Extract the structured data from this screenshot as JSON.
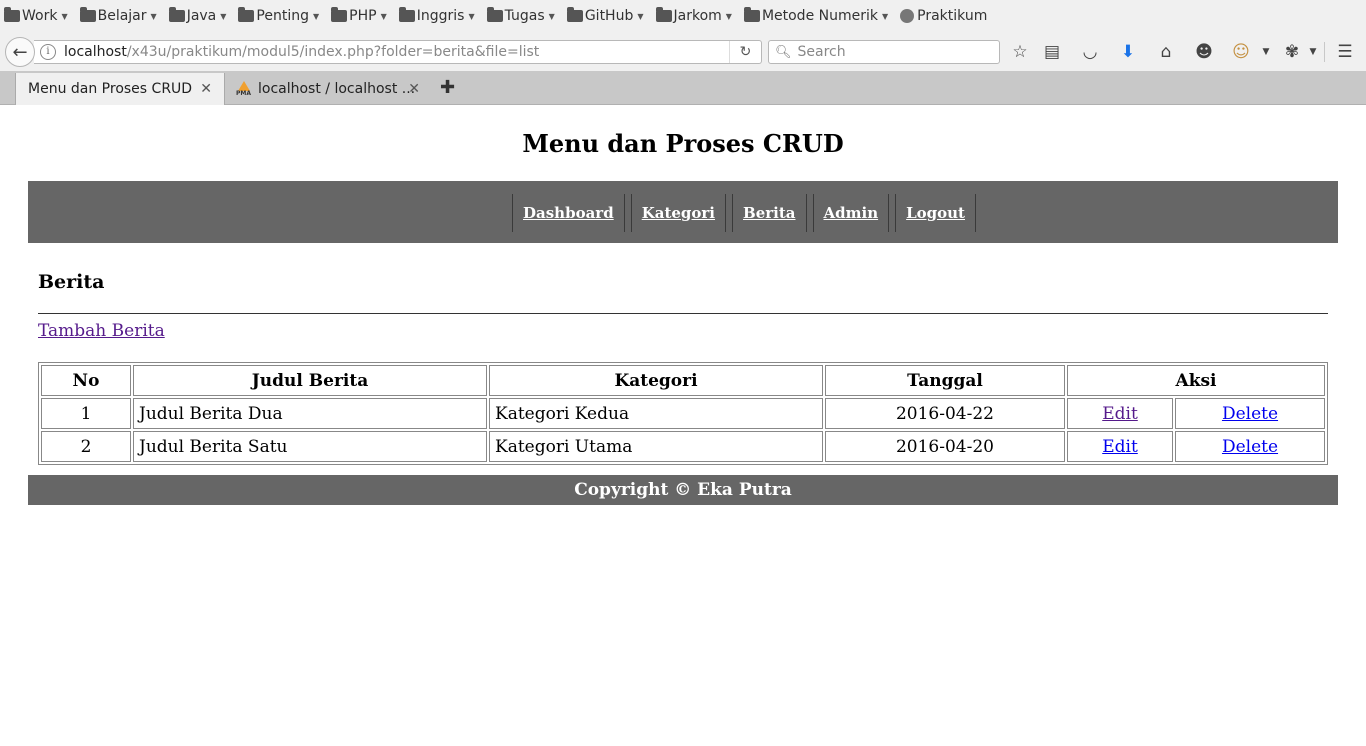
{
  "browser": {
    "bookmarks": [
      {
        "label": "Work",
        "type": "folder"
      },
      {
        "label": "Belajar",
        "type": "folder"
      },
      {
        "label": "Java",
        "type": "folder"
      },
      {
        "label": "Penting",
        "type": "folder"
      },
      {
        "label": "PHP",
        "type": "folder"
      },
      {
        "label": "Inggris",
        "type": "folder"
      },
      {
        "label": "Tugas",
        "type": "folder"
      },
      {
        "label": "GitHub",
        "type": "folder"
      },
      {
        "label": "Jarkom",
        "type": "folder"
      },
      {
        "label": "Metode Numerik",
        "type": "folder"
      },
      {
        "label": "Praktikum",
        "type": "link"
      }
    ],
    "url_host": "localhost",
    "url_path": "/x43u/praktikum/modul5/index.php?folder=berita&file=list",
    "search_placeholder": "Search",
    "tabs": [
      {
        "title": "Menu dan Proses CRUD",
        "active": true
      },
      {
        "title": "localhost / localhost ...",
        "active": false
      }
    ],
    "new_tab": "✚",
    "toolbar_icons": [
      "star-icon",
      "reading-list-icon",
      "pocket-icon",
      "download-icon",
      "home-icon",
      "smiley-icon",
      "monkey-icon",
      "extension-icon",
      "menu-icon"
    ]
  },
  "page": {
    "title": "Menu dan Proses CRUD",
    "menu": [
      "Dashboard",
      "Kategori",
      "Berita",
      "Admin",
      "Logout"
    ],
    "section_title": "Berita",
    "add_link": "Tambah Berita",
    "table": {
      "headers": [
        "No",
        "Judul Berita",
        "Kategori",
        "Tanggal",
        "Aksi"
      ],
      "rows": [
        {
          "no": "1",
          "judul": "Judul Berita Dua",
          "kategori": "Kategori Kedua",
          "tanggal": "2016-04-22",
          "edit": "Edit",
          "delete": "Delete"
        },
        {
          "no": "2",
          "judul": "Judul Berita Satu",
          "kategori": "Kategori Utama",
          "tanggal": "2016-04-20",
          "edit": "Edit",
          "delete": "Delete"
        }
      ]
    },
    "footer": "Copyright © Eka Putra"
  }
}
